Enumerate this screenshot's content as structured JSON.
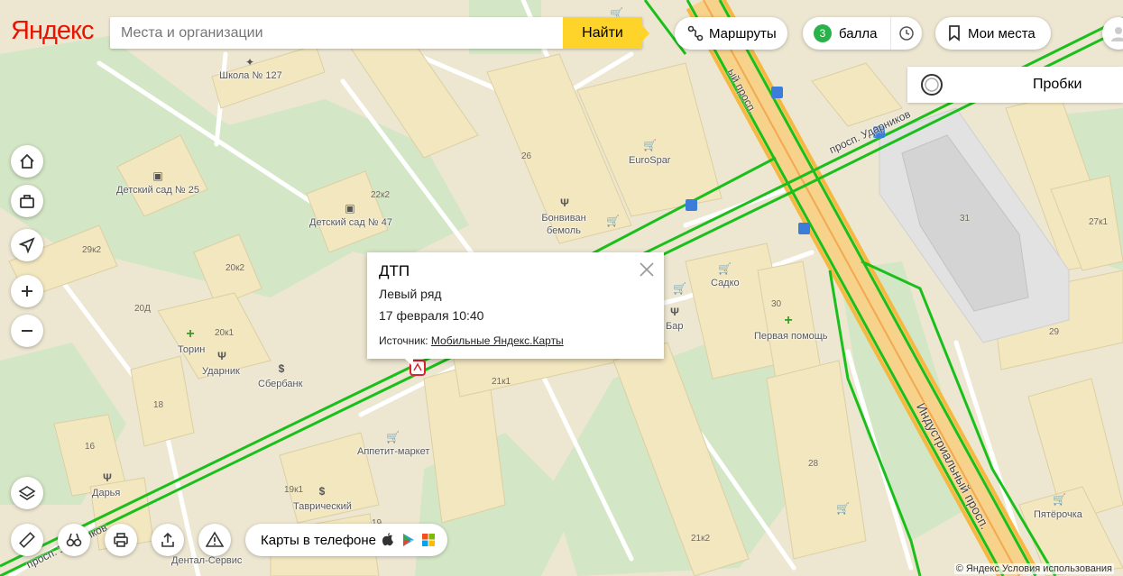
{
  "header": {
    "logo": "Яндекс",
    "search": {
      "placeholder": "Места и организации",
      "value": "",
      "button_label": "Найти"
    },
    "routes_label": "Маршруты",
    "points": {
      "count": "3",
      "label": "балла"
    },
    "my_places_label": "Мои места"
  },
  "traffic": {
    "label": "Пробки"
  },
  "left_controls": [
    {
      "name": "home-icon"
    },
    {
      "name": "briefcase-icon"
    },
    {
      "name": "location-arrow-icon"
    },
    {
      "name": "zoom-in-icon"
    },
    {
      "name": "zoom-out-icon"
    },
    {
      "name": "layers-icon"
    }
  ],
  "bottom_bar": {
    "phone_label": "Карты в телефоне",
    "icons": [
      "ruler-icon",
      "panorama-icon",
      "print-icon",
      "share-icon",
      "warning-icon",
      "apple-icon",
      "google-play-icon",
      "windows-icon"
    ]
  },
  "popup": {
    "title": "ДТП",
    "lane": "Левый ряд",
    "datetime": "17 февраля 10:40",
    "source_label": "Источник:",
    "source_link": "Мобильные Яндекс.Карты"
  },
  "copyright": "© Яндекс Условия использования",
  "map": {
    "poi_labels": {
      "school": "Школа № 127",
      "kindergarten25": "Детский сад № 25",
      "kindergarten47": "Детский сад № 47",
      "eurospar": "EuroSpar",
      "bonvivan": "Бонвиван бемоль",
      "sadko": "Садко",
      "bar": "Бар",
      "first_aid": "Первая помощь",
      "torin": "Торин",
      "udarnik": "Ударник",
      "sberbank": "Сбербанк",
      "appetit": "Аппетит-маркет",
      "darya": "Дарья",
      "tavrichesky": "Таврический",
      "dental": "Дентал-Сервис",
      "pyaterochka": "Пятёрочка"
    },
    "building_numbers": {
      "b26": "26",
      "b22k2": "22к2",
      "b29k2": "29к2",
      "b20k2": "20к2",
      "b20d": "20Д",
      "b20k1": "20к1",
      "b18": "18",
      "b16": "16",
      "b19k1": "19к1",
      "b21k1": "21к1",
      "b30": "30",
      "b31": "31",
      "b27k1": "27к1",
      "b29": "29",
      "b28": "28",
      "b21k2": "21к2",
      "b19": "19"
    },
    "streets": {
      "udarnikov": "просп. Ударников",
      "industrialny_top": "ый просп.",
      "industrialny_bottom": "Индустриальный просп.",
      "udarnikov_bottom": "просп. Ударников"
    },
    "colors": {
      "traffic_free": "#1bbf1b",
      "highway": "#f7c85b",
      "building": "#f2e6bd",
      "park": "#cde3c0",
      "background": "#f1ecdc"
    }
  }
}
